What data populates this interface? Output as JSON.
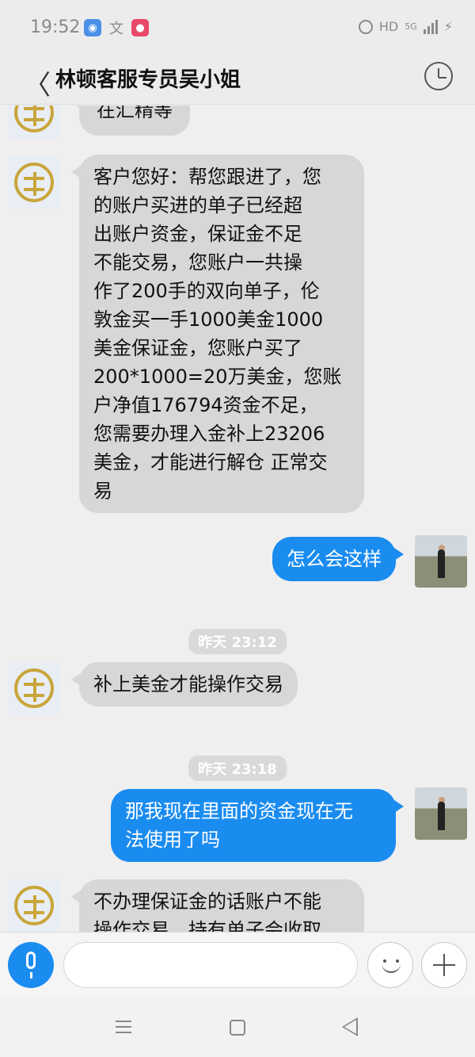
{
  "status_bar": {
    "time": "19:52",
    "network": "HD",
    "signal_label": "5G",
    "icons": [
      "wifi-app-icon",
      "translate-icon",
      "app-red-icon",
      "alarm-icon",
      "signal-icon",
      "charging-icon"
    ]
  },
  "header": {
    "back_glyph": "〈",
    "title": "林顿客服专员吴小姐",
    "history_icon": "clock-icon"
  },
  "messages": [
    {
      "side": "left",
      "text": "在汇精等",
      "partial": true
    },
    {
      "side": "left",
      "lines": [
        "客户您好：帮您跟进了，您",
        "的账户买进的单子已经超",
        "出账户资金，保证金不足",
        "不能交易，您账户一共操",
        "作了200手的双向单子，伦",
        "敦金买一手1000美金1000",
        "美金保证金，您账户买了",
        "200*1000=20万美金，您账",
        "户净值176794资金不足，",
        "您需要办理入金补上23206",
        "美金，才能进行解仓 正常交",
        "易"
      ]
    },
    {
      "side": "right",
      "text": "怎么会这样"
    },
    {
      "type": "time",
      "text": "昨天 23:12"
    },
    {
      "side": "left",
      "text": "补上美金才能操作交易"
    },
    {
      "type": "time",
      "text": "昨天 23:18"
    },
    {
      "side": "right",
      "lines": [
        "那我现在里面的资金现在无",
        "法使用了吗"
      ]
    },
    {
      "side": "left",
      "lines": [
        "不办理保证金的话账户不能",
        "操作交易，持有单子会收取"
      ],
      "partial": true
    }
  ],
  "input_bar": {
    "placeholder": "",
    "mic_icon": "microphone-icon",
    "emoji_icon": "emoji-icon",
    "plus_icon": "plus-icon"
  },
  "nav_bar": [
    "menu-icon",
    "home-icon",
    "back-triangle-icon"
  ],
  "colors": {
    "bubble_right": "#1a8cf0",
    "bubble_left": "#d7d7d7",
    "logo_gold": "#c9a53b",
    "background": "#efefef"
  }
}
